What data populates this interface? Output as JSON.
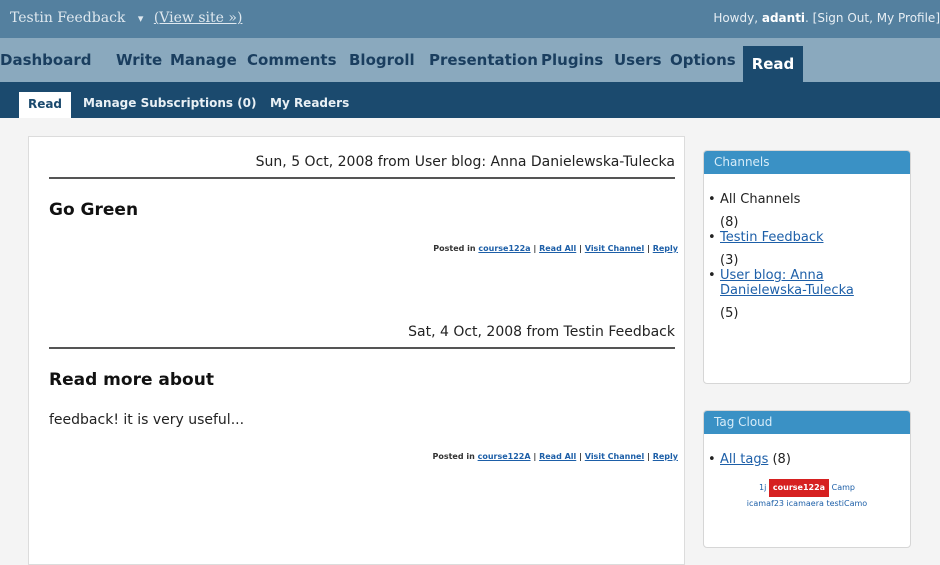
{
  "topbar": {
    "site_title": "Testin Feedback",
    "view_site": "(View site »)",
    "greeting_prefix": "Howdy,",
    "username": "adanti",
    "greeting_suffix": ". [Sign Out, My Profile]"
  },
  "mainnav": {
    "items": [
      "Dashboard",
      "Write",
      "Manage",
      "Comments",
      "Blogroll",
      "Presentation",
      "Plugins",
      "Users",
      "Options",
      "Read"
    ],
    "active": "Read"
  },
  "subnav": {
    "items": [
      "Read",
      "Manage Subscriptions (0)",
      "My Readers"
    ],
    "active": "Read"
  },
  "posts": [
    {
      "date_line": "Sun, 5 Oct, 2008 from User blog: Anna Danielewska-Tulecka",
      "title": "Go Green",
      "excerpt": "",
      "posted_in_label": "Posted in",
      "category": "course122a",
      "read_all": "Read All",
      "visit_channel": "Visit Channel",
      "reply": "Reply",
      "separator": "|"
    },
    {
      "date_line": "Sat, 4 Oct, 2008 from Testin Feedback",
      "title": "Read more about",
      "excerpt": "feedback! it is very useful...",
      "posted_in_label": "Posted in",
      "category": "course122A",
      "read_all": "Read All",
      "visit_channel": "Visit Channel",
      "reply": "Reply",
      "separator": "|"
    }
  ],
  "channels": {
    "heading": "Channels",
    "items": [
      {
        "label": "All Channels",
        "count": "(8)"
      },
      {
        "label": "Testin Feedback",
        "count": "(3)"
      },
      {
        "label": "User blog: Anna Danielewska-Tulecka",
        "count": "(5)"
      }
    ]
  },
  "tag_cloud": {
    "heading": "Tag Cloud",
    "all_tags": "All tags",
    "all_tags_count": "(8)",
    "tags_line1": [
      "1j",
      "course122a",
      "Camp"
    ],
    "highlighted_tag": "course122a",
    "tags_line2": [
      "icamaf23",
      "icamaera",
      "testiCamo"
    ]
  },
  "colors": {
    "topbar": "#54809f",
    "mainnav": "#8aa9be",
    "subnav": "#1b4a6e",
    "widget_header": "#3a91c5",
    "link": "#1d5fa8",
    "highlight": "#d62020"
  }
}
